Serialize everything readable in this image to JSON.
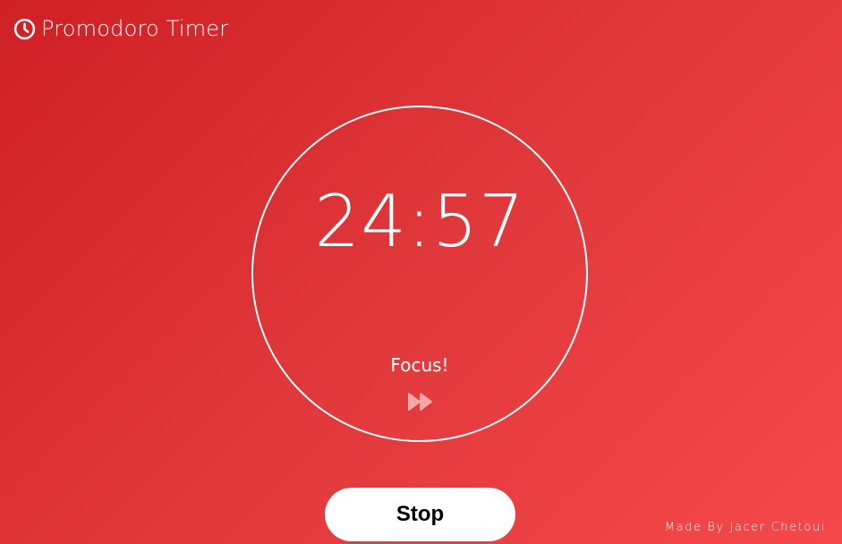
{
  "header": {
    "title": "Promodoro Timer",
    "icon": "clock-icon"
  },
  "timer": {
    "time": "24:57",
    "phase": "Focus!",
    "skip_icon": "fast-forward-icon"
  },
  "controls": {
    "stop_label": "Stop"
  },
  "footer": {
    "credit": "Made By Jacer Chetoui"
  },
  "colors": {
    "background_start": "#cf2024",
    "background_end": "#f5484a",
    "foreground": "#ffffff",
    "button_text": "#000000"
  }
}
